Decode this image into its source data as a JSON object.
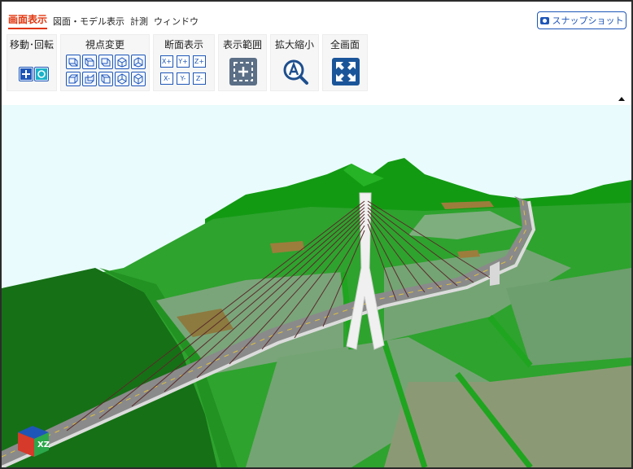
{
  "menu": {
    "tabs": [
      {
        "label": "画面表示"
      },
      {
        "label": "図面・モデル表示"
      },
      {
        "label": "計測"
      },
      {
        "label": "ウィンドウ"
      }
    ],
    "snapshot_label": "スナップショット"
  },
  "toolbar": {
    "move_rotate": {
      "title": "移動･回転"
    },
    "viewpoint": {
      "title": "視点変更"
    },
    "section": {
      "title": "断面表示",
      "buttons": [
        "X+",
        "Y+",
        "Z+",
        "X-",
        "Y-",
        "Z-"
      ]
    },
    "display_range": {
      "title": "表示範囲"
    },
    "zoom": {
      "title": "拡大縮小"
    },
    "fullscreen": {
      "title": "全画面"
    }
  },
  "gizmo": {
    "label": "XZ"
  },
  "colors": {
    "accent": "#e2360e",
    "brand_blue": "#1e56b8",
    "sky": "#e9fbfc",
    "terrain_green": "#2ea32e",
    "field_green": "#74a474"
  },
  "icons": [
    "camera-icon",
    "move-icon",
    "rotate-icon",
    "view-cube-icons",
    "fit-range-icon",
    "zoom-icon",
    "fullscreen-icon",
    "collapse-arrow-icon"
  ]
}
